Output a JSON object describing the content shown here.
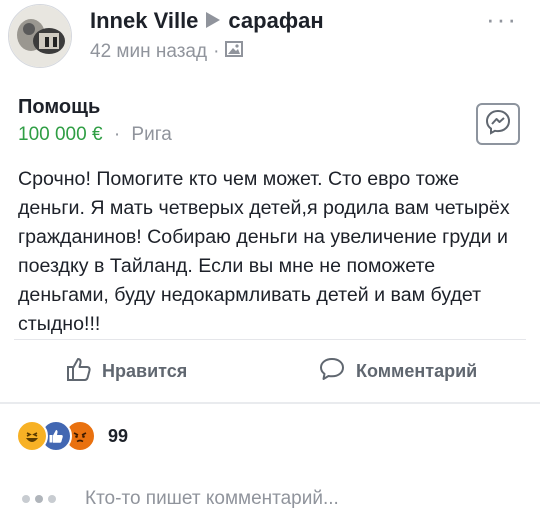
{
  "post": {
    "author": "Innek Ville",
    "audience": "сарафан",
    "time": "42 мин назад",
    "privacy_icon": "privacy-image-icon",
    "more_icon": "more-dots-icon"
  },
  "listing": {
    "title": "Помощь",
    "price": "100 000 €",
    "location": "Рига",
    "messenger_icon": "messenger-icon"
  },
  "body_text": "Срочно! Помогите кто чем может. Сто евро тоже деньги. Я мать четверых детей,я родила вам четырёх гражданинов! Собираю деньги на увеличение груди и поездку в Тайланд. Если вы мне не поможете деньгами, буду недокармливать детей и вам будет стыдно!!!",
  "actions": {
    "like_label": "Нравится",
    "comment_label": "Комментарий"
  },
  "reactions": {
    "icons": [
      "haha-icon",
      "like-icon",
      "angry-icon"
    ],
    "count": "99"
  },
  "typing": {
    "text": "Кто-то пишет комментарий..."
  },
  "colors": {
    "price_green": "#2f9e44",
    "like_blue": "#4267b2",
    "haha_yellow": "#f7b125",
    "angry_orange": "#e9710f",
    "muted_gray": "#90949c"
  }
}
